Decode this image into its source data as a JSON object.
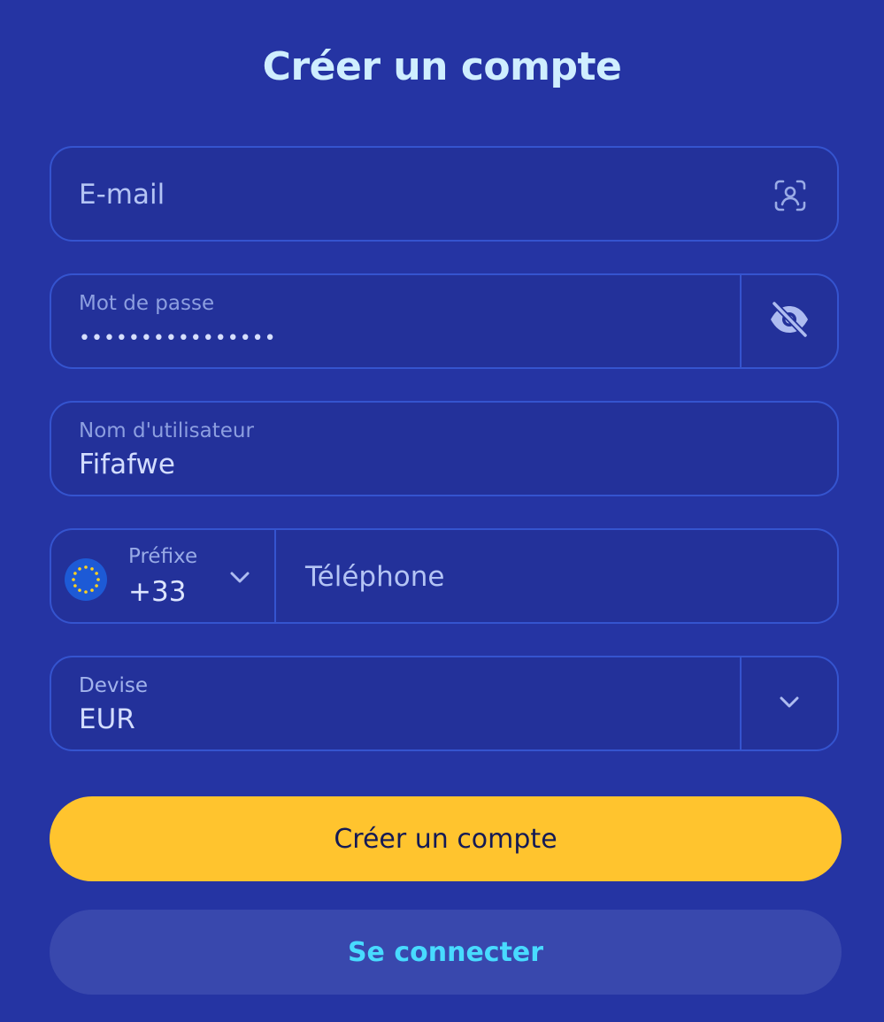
{
  "title": "Créer un compte",
  "form": {
    "email": {
      "placeholder": "E-mail",
      "icon": "user-scan-icon"
    },
    "password": {
      "label": "Mot de passe",
      "value": "••••••••••••••••",
      "icon": "eye-off-icon"
    },
    "username": {
      "label": "Nom d'utilisateur",
      "value": "Fifafwe"
    },
    "phone": {
      "prefix_label": "Préfixe",
      "prefix_value": "+33",
      "flag_icon": "eu-flag-icon",
      "chevron_icon": "chevron-down-icon",
      "placeholder": "Téléphone"
    },
    "currency": {
      "label": "Devise",
      "value": "EUR",
      "chevron_icon": "chevron-down-icon"
    }
  },
  "buttons": {
    "create": "Créer un compte",
    "login": "Se connecter"
  },
  "colors": {
    "background": "#2534a3",
    "field_border": "#3554cf",
    "primary_button": "#ffc42e",
    "secondary_button": "#3948ad",
    "link_text": "#48dbff"
  }
}
